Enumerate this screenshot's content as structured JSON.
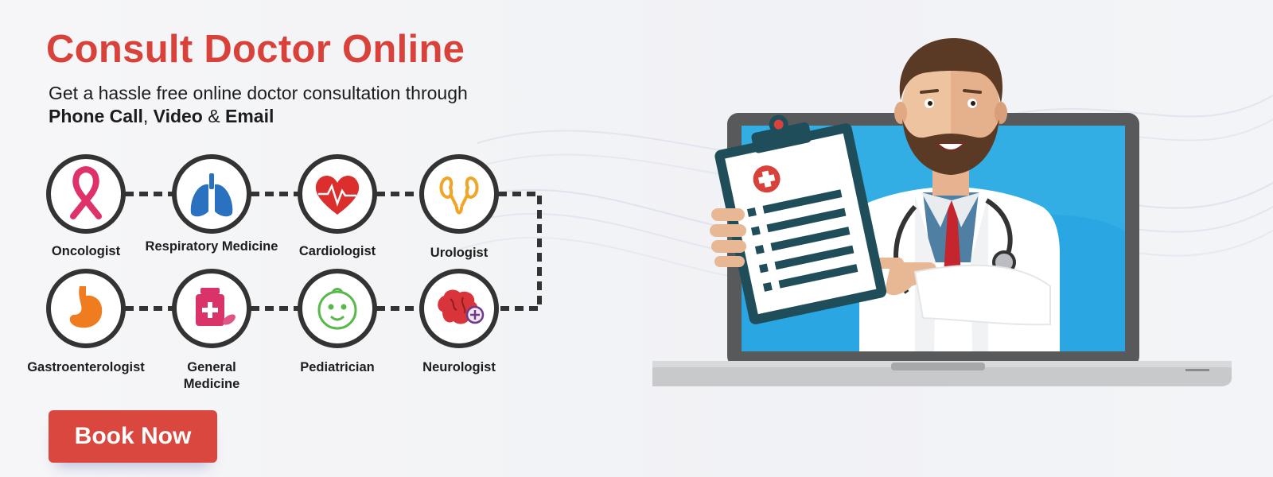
{
  "hero": {
    "title": "Consult Doctor Online",
    "subtitle_line1": "Get a hassle free online doctor consultation through",
    "channel_1": "Phone Call",
    "sep_1": ",",
    "channel_2": "Video",
    "sep_2": "&",
    "channel_3": "Email"
  },
  "specialties": {
    "row1": [
      {
        "label": "Oncologist",
        "icon": "ribbon-icon"
      },
      {
        "label": "Respiratory Medicine",
        "icon": "lungs-icon"
      },
      {
        "label": "Cardiologist",
        "icon": "heart-icon"
      },
      {
        "label": "Urologist",
        "icon": "kidney-icon"
      }
    ],
    "row2": [
      {
        "label": "Gastroenterologist",
        "icon": "stomach-icon"
      },
      {
        "label": "General Medicine",
        "icon": "medicine-bottle-icon"
      },
      {
        "label": "Pediatrician",
        "icon": "baby-face-icon"
      },
      {
        "label": "Neurologist",
        "icon": "brain-icon"
      }
    ]
  },
  "cta": {
    "label": "Book Now"
  },
  "colors": {
    "brand_red": "#d9413b",
    "circle_border": "#333333",
    "screen_blue": "#2aa7e2",
    "lab_coat": "#ffffff"
  }
}
